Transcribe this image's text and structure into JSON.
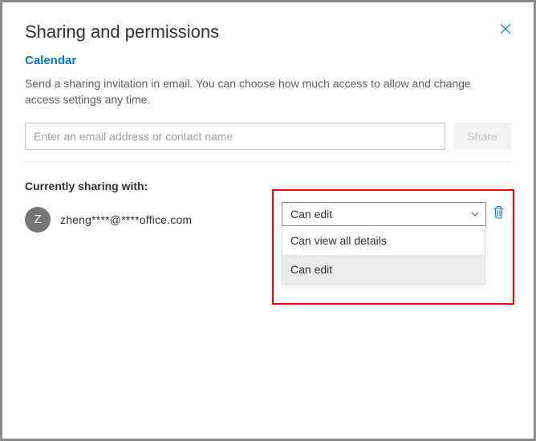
{
  "header": {
    "title": "Sharing and permissions"
  },
  "calendar": {
    "name": "Calendar",
    "description": "Send a sharing invitation in email. You can choose how much access to allow and change access settings any time."
  },
  "input": {
    "placeholder": "Enter an email address or contact name",
    "share_label": "Share"
  },
  "sharing": {
    "heading": "Currently sharing with:",
    "entries": [
      {
        "initial": "Z",
        "display": "zheng****@****office.com",
        "permission_selected": "Can edit"
      }
    ],
    "options": [
      "Can view all details",
      "Can edit"
    ]
  }
}
